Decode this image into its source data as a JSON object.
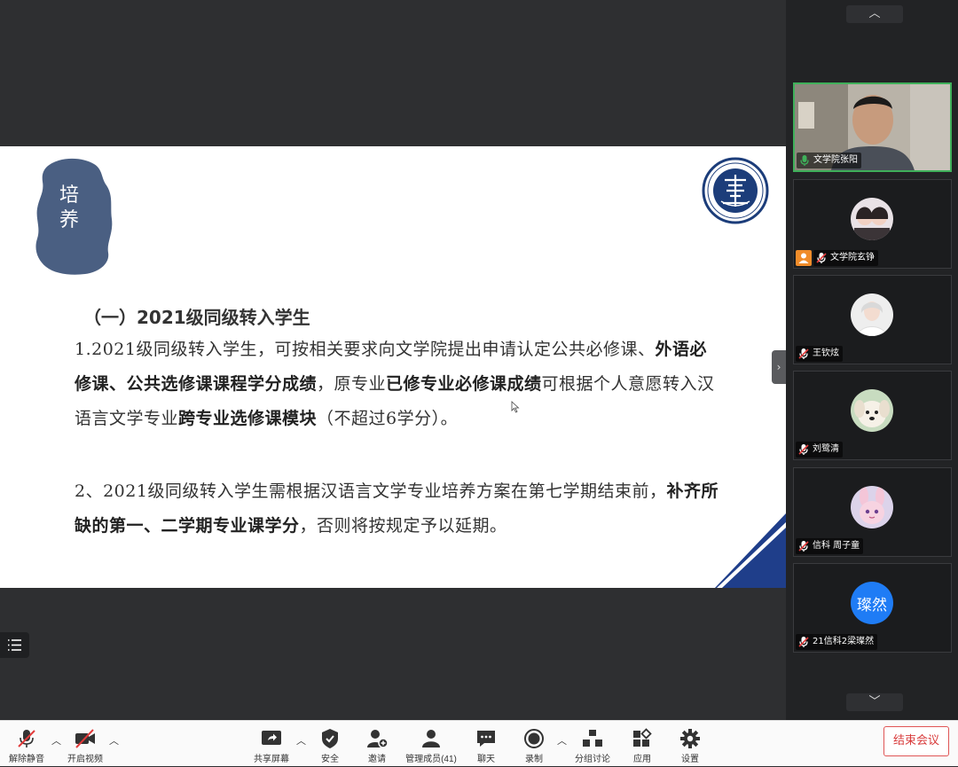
{
  "slide": {
    "seal_text": "培\n养",
    "heading": "（一）2021级同级转入学生",
    "para1": [
      {
        "t": "1.2021级同级转入学生，可按相关要求向文学院提出申请认定公共必修课、",
        "b": false
      },
      {
        "t": "外语必修课、公共选修课课程学分成绩",
        "b": true
      },
      {
        "t": "，原专业",
        "b": false
      },
      {
        "t": "已修专业必修课成绩",
        "b": true
      },
      {
        "t": "可根据个人意愿转入汉语言文学专业",
        "b": false
      },
      {
        "t": "跨专业选修课模块",
        "b": true
      },
      {
        "t": "（不超过6学分）。",
        "b": false
      }
    ],
    "para2": [
      {
        "t": "2、2021级同级转入学生需根据汉语言文学专业培养方案在第七学期结束前，",
        "b": false
      },
      {
        "t": "补齐所缺的第一、二学期专业课学分",
        "b": true
      },
      {
        "t": "，否则将按规定予以延期。",
        "b": false
      }
    ]
  },
  "participants": [
    {
      "name": "文学院张阳",
      "kind": "video",
      "mic": "on"
    },
    {
      "name": "文学院玄铮",
      "kind": "photo",
      "mic": "muted",
      "host": true
    },
    {
      "name": "王钦炫",
      "kind": "photo",
      "mic": "muted"
    },
    {
      "name": "刘鹭清",
      "kind": "photo",
      "mic": "muted"
    },
    {
      "name": "信科 周子童",
      "kind": "photo",
      "mic": "muted"
    },
    {
      "name": "21信科2梁璨然",
      "kind": "initials",
      "initials": "璨然",
      "mic": "muted",
      "color": "#1f7cf5"
    }
  ],
  "toolbar": {
    "unmute": "解除静音",
    "start_video": "开启视频",
    "share_screen": "共享屏幕",
    "security": "安全",
    "invite": "邀请",
    "manage_members": "管理成员(41)",
    "chat": "聊天",
    "record": "录制",
    "breakout": "分组讨论",
    "apps": "应用",
    "settings": "设置",
    "end_meeting": "结束会议"
  },
  "colors": {
    "accent_green": "#3fb05a",
    "end_red": "#d83a3a",
    "seal_blue": "#4a5f82",
    "corner_blue": "#1f3e8a",
    "avatar_blue": "#1f7cf5"
  }
}
